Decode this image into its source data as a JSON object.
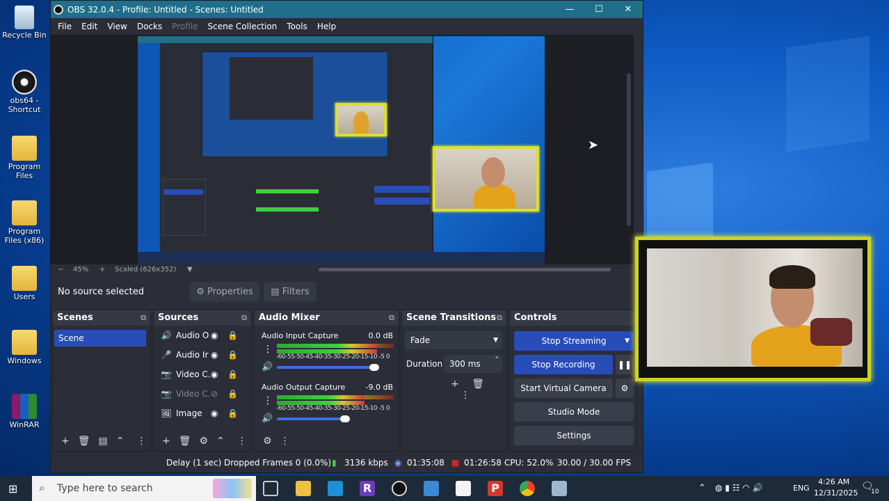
{
  "desktop": {
    "icons": [
      {
        "label": "Recycle Bin",
        "icon": "recycle-bin-icon"
      },
      {
        "label": "obs64 - Shortcut",
        "icon": "obs-icon"
      },
      {
        "label": "Program Files",
        "icon": "folder-icon"
      },
      {
        "label": "Program Files (x86)",
        "icon": "folder-icon"
      },
      {
        "label": "Users",
        "icon": "folder-icon"
      },
      {
        "label": "Windows",
        "icon": "folder-icon"
      },
      {
        "label": "WinRAR",
        "icon": "winrar-icon"
      }
    ]
  },
  "window": {
    "title": "OBS 32.0.4 - Profile: Untitled - Scenes: Untitled",
    "minimize": "—",
    "maximize": "☐",
    "close": "✕"
  },
  "menu": [
    "File",
    "Edit",
    "View",
    "Docks",
    "Profile",
    "Scene Collection",
    "Tools",
    "Help"
  ],
  "preview": {
    "zoom": "45%",
    "scaled": "Scaled (626x352)"
  },
  "source_bar": {
    "no_source": "No source selected",
    "properties": "Properties",
    "filters": "Filters"
  },
  "scenes": {
    "title": "Scenes",
    "items": [
      "Scene"
    ]
  },
  "sources": {
    "title": "Sources",
    "items": [
      {
        "label": "Audio O",
        "icon": "speaker-icon",
        "dimmed": false
      },
      {
        "label": "Audio Ir",
        "icon": "microphone-icon",
        "dimmed": false
      },
      {
        "label": "Video C.",
        "icon": "camera-icon",
        "dimmed": false
      },
      {
        "label": "Video C.",
        "icon": "camera-icon",
        "dimmed": true
      },
      {
        "label": "Image",
        "icon": "image-icon",
        "dimmed": false
      }
    ]
  },
  "mixer": {
    "title": "Audio Mixer",
    "channels": [
      {
        "name": "Audio Input Capture",
        "db": "0.0 dB",
        "level": 0.86,
        "volume": 1.0
      },
      {
        "name": "Audio Output Capture",
        "db": "-9.0 dB",
        "level": 0.75,
        "volume": 0.7
      }
    ],
    "ticks": "-60-55-50-45-40-35-30-25-20-15-10 -5  0"
  },
  "transitions": {
    "title": "Scene Transitions",
    "selected": "Fade",
    "duration_label": "Duration",
    "duration_value": "300 ms"
  },
  "controls": {
    "title": "Controls",
    "stop_streaming": "Stop Streaming",
    "stop_recording": "Stop Recording",
    "start_virtual_camera": "Start Virtual Camera",
    "studio_mode": "Studio Mode",
    "settings": "Settings"
  },
  "status": {
    "delay": "Delay (1 sec)",
    "dropped": "Dropped Frames 0 (0.0%)",
    "bitrate": "3136 kbps",
    "stream_time": "01:35:08",
    "record_time": "01:26:58",
    "cpu": "CPU: 52.0%",
    "fps": "30.00 / 30.00 FPS"
  },
  "taskbar": {
    "search_placeholder": "Type here to search",
    "time": "4:26 AM",
    "date": "12/31/2025",
    "lang": "ENG",
    "notif_count": "10"
  },
  "colors": {
    "accent": "#284cb8",
    "title_bar": "#1f6f8b",
    "record_red": "#e02020",
    "webcam_border": "#ccd41e"
  }
}
